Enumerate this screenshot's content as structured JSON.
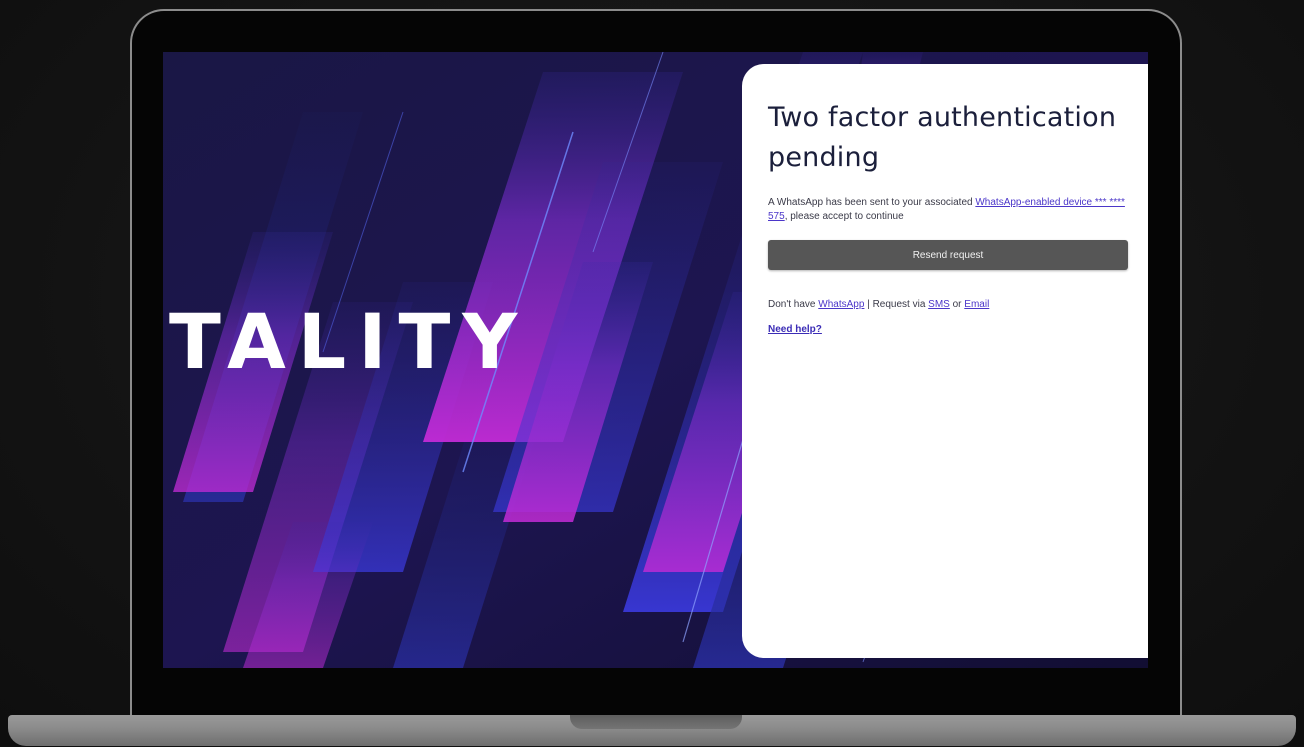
{
  "hero": {
    "brand_text": "TALITY"
  },
  "auth": {
    "title": "Two factor authentication pending",
    "message_prefix": "A WhatsApp has been sent to your associated ",
    "device_link": "WhatsApp-enabled device *** **** 575",
    "message_suffix": ", please accept to continue",
    "resend_label": "Resend request",
    "alt_prefix": "Don't have ",
    "alt_whatsapp_link": "WhatsApp",
    "alt_middle": " | Request via ",
    "alt_sms_link": "SMS",
    "alt_or": " or ",
    "alt_email_link": "Email",
    "help_link": "Need help?"
  },
  "colors": {
    "button_bg": "#565656",
    "link": "#4b36c9",
    "title": "#1b1f3b",
    "hero_bg": "#15113a"
  }
}
